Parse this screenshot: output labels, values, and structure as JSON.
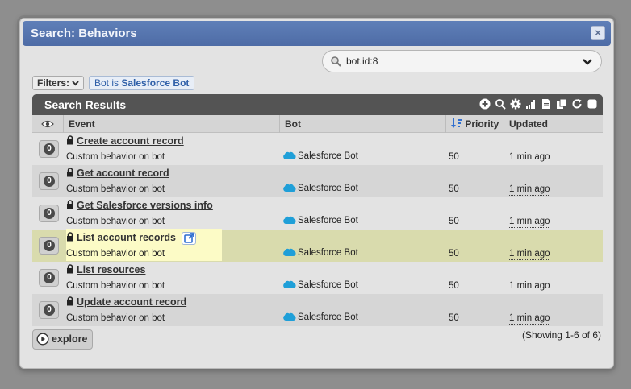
{
  "dialog": {
    "title": "Search: Behaviors",
    "close_label": "×"
  },
  "search": {
    "value": "bot.id:8"
  },
  "filters": {
    "button_label": "Filters:",
    "chip_prefix": "Bot is ",
    "chip_value": "Salesforce Bot"
  },
  "results": {
    "title": "Search Results",
    "toolbar_icons": [
      "add-icon",
      "search-icon",
      "gear-icon",
      "bar-chart-icon",
      "export-icon",
      "copy-icon",
      "refresh-icon",
      "stop-icon"
    ],
    "columns": {
      "event": "Event",
      "bot": "Bot",
      "priority": "Priority",
      "updated": "Updated"
    },
    "rows": [
      {
        "count": "0",
        "name": "Create account record",
        "desc": "Custom behavior on bot",
        "bot": "Salesforce Bot",
        "priority": "50",
        "updated": "1 min ago"
      },
      {
        "count": "0",
        "name": "Get account record",
        "desc": "Custom behavior on bot",
        "bot": "Salesforce Bot",
        "priority": "50",
        "updated": "1 min ago"
      },
      {
        "count": "0",
        "name": "Get Salesforce versions info",
        "desc": "Custom behavior on bot",
        "bot": "Salesforce Bot",
        "priority": "50",
        "updated": "1 min ago"
      },
      {
        "count": "0",
        "name": "List account records",
        "desc": "Custom behavior on bot",
        "bot": "Salesforce Bot",
        "priority": "50",
        "updated": "1 min ago"
      },
      {
        "count": "0",
        "name": "List resources",
        "desc": "Custom behavior on bot",
        "bot": "Salesforce Bot",
        "priority": "50",
        "updated": "1 min ago"
      },
      {
        "count": "0",
        "name": "Update account record",
        "desc": "Custom behavior on bot",
        "bot": "Salesforce Bot",
        "priority": "50",
        "updated": "1 min ago"
      }
    ],
    "explore_label": "explore",
    "showing": "(Showing 1-6 of 6)"
  },
  "colors": {
    "title_bar": "#5574ae",
    "results_bar": "#545454",
    "highlight_row": "#d9dbad",
    "link_blue": "#2f5fa8"
  }
}
